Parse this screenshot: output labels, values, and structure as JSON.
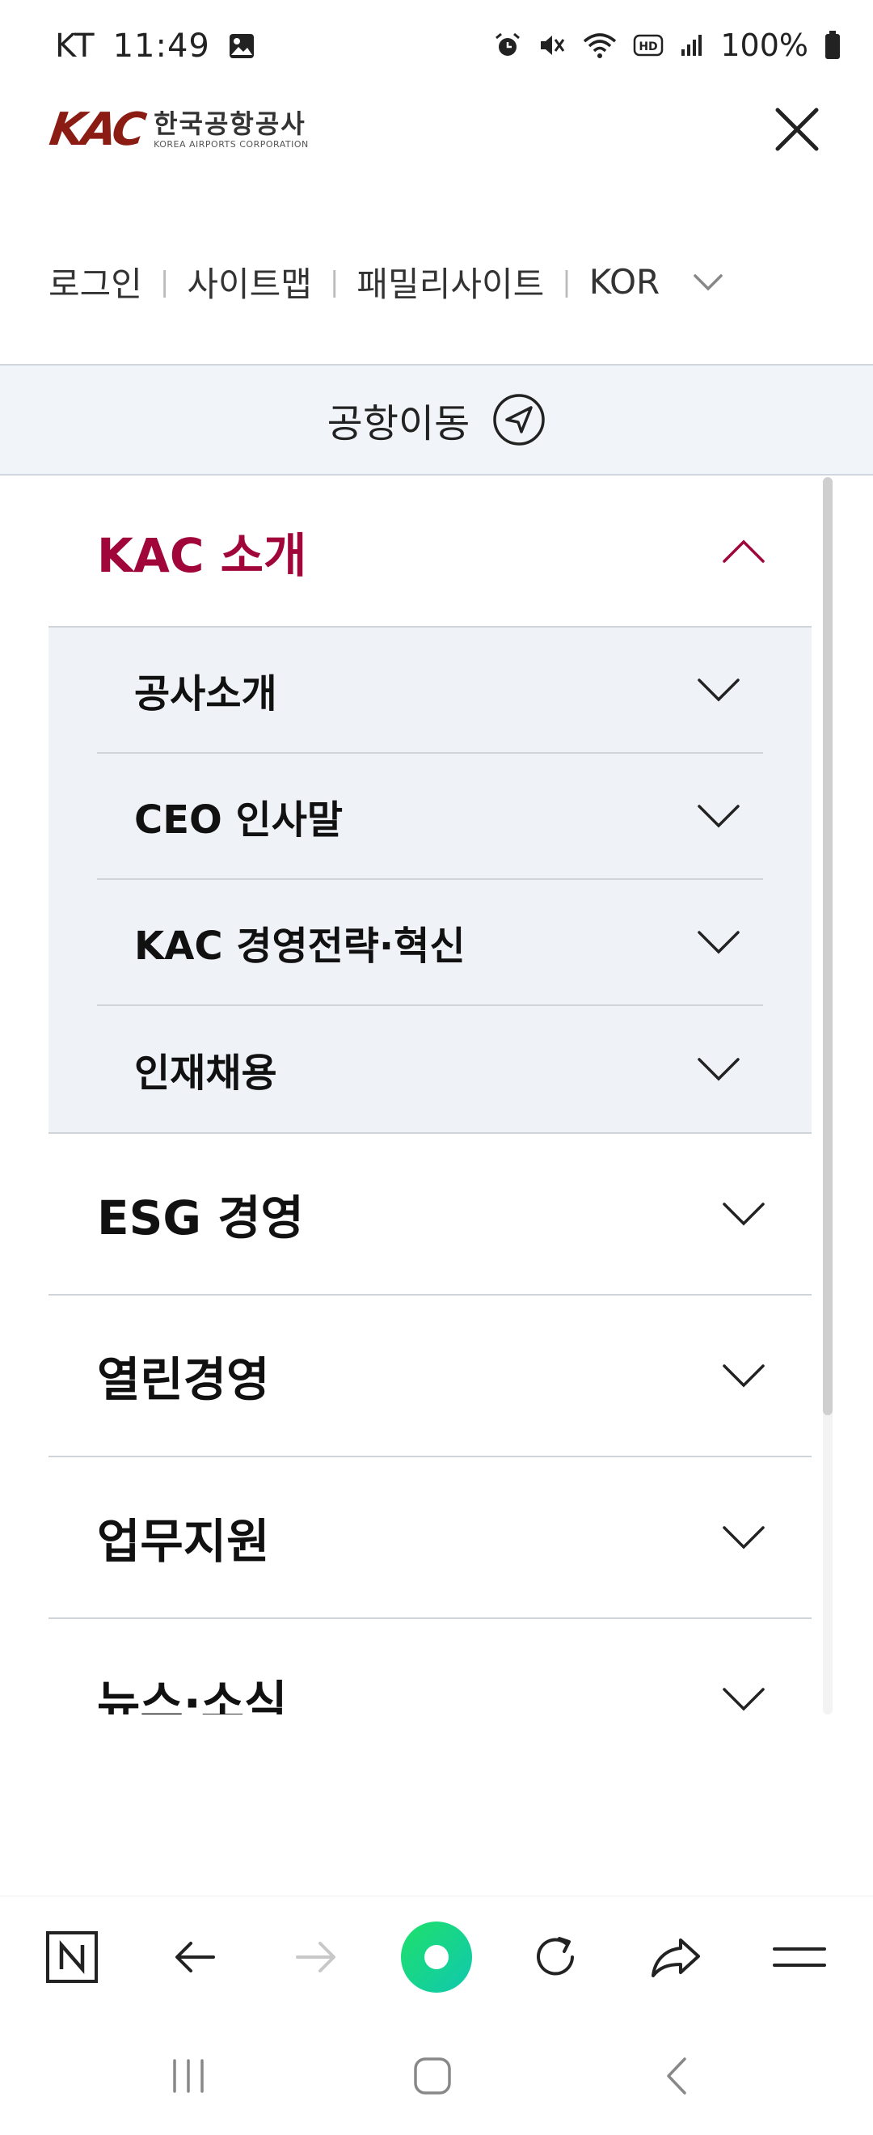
{
  "status_bar": {
    "carrier": "KT",
    "time": "11:49",
    "battery": "100%"
  },
  "header": {
    "logo_mark": "KAC",
    "logo_korean": "한국공항공사",
    "logo_english": "KOREA AIRPORTS CORPORATION"
  },
  "util_nav": {
    "login": "로그인",
    "sitemap": "사이트맵",
    "family_site": "패밀리사이트",
    "language": "KOR"
  },
  "airport_bar": {
    "label": "공항이동"
  },
  "menu": {
    "items": [
      {
        "label": "KAC 소개",
        "expanded": true,
        "children": [
          {
            "label": "공사소개"
          },
          {
            "label": "CEO 인사말"
          },
          {
            "label": "KAC 경영전략·혁신"
          },
          {
            "label": "인재채용"
          }
        ]
      },
      {
        "label": "ESG 경영",
        "expanded": false
      },
      {
        "label": "열린경영",
        "expanded": false
      },
      {
        "label": "업무지원",
        "expanded": false
      },
      {
        "label": "뉴스·소식",
        "expanded": false
      }
    ]
  },
  "colors": {
    "accent": "#a0063a",
    "logo": "#8a1c14",
    "panel_bg": "#f1f5f9",
    "browser_green": "#1fd37a"
  },
  "icons": {
    "close": "close-icon",
    "airport": "navigation-arrow-icon",
    "browser_home": "naver-n-icon",
    "back": "arrow-left-icon",
    "forward": "arrow-right-icon",
    "green_dot": "greendot-icon",
    "refresh": "refresh-icon",
    "share": "share-icon",
    "menu": "menu-icon"
  }
}
